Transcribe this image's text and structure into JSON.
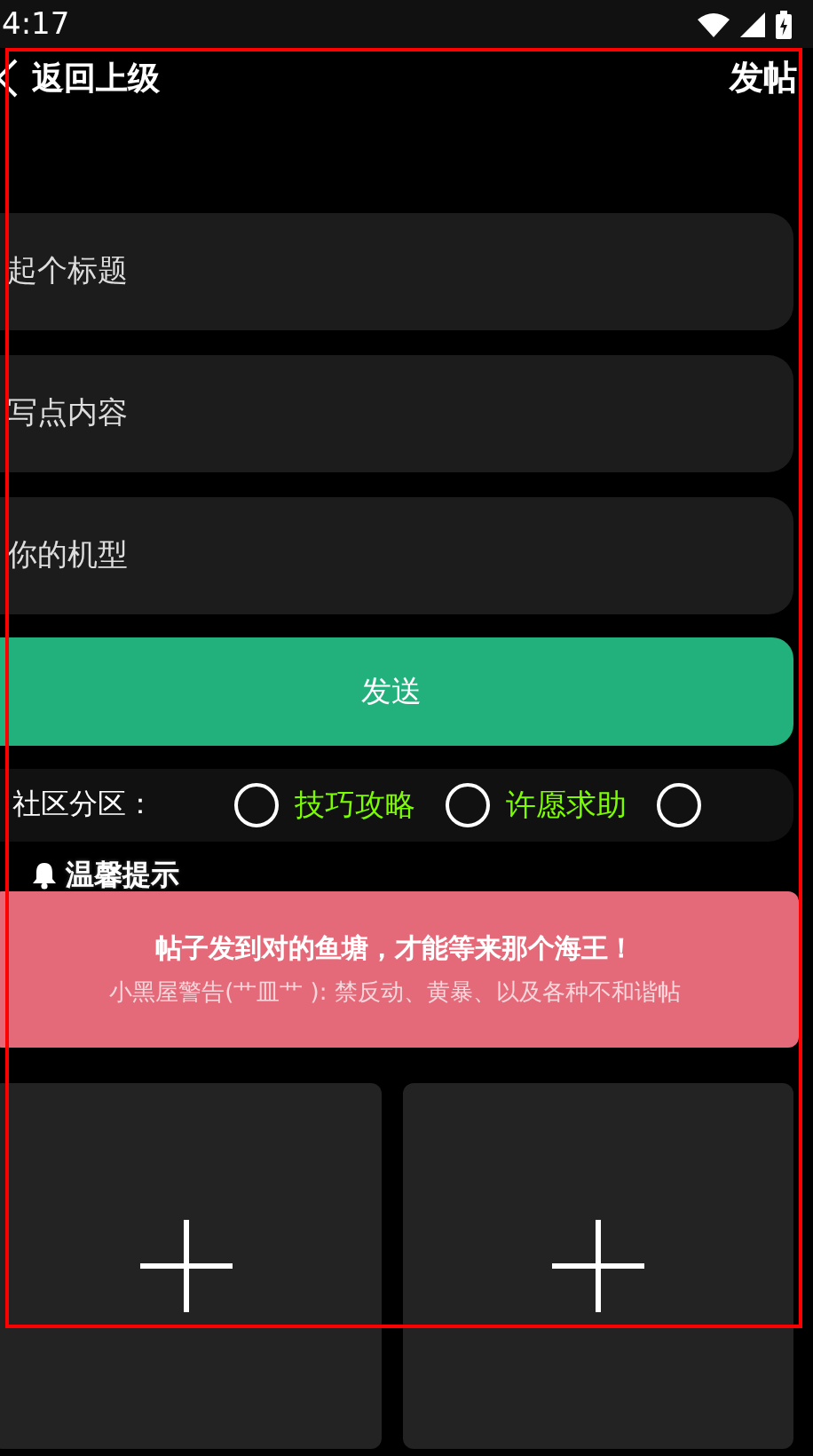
{
  "status_bar": {
    "time": "4:17"
  },
  "header": {
    "back_label": "返回上级",
    "action": "发帖"
  },
  "fields": [
    {
      "placeholder": "起个标题"
    },
    {
      "placeholder": "写点内容"
    },
    {
      "placeholder": "你的机型"
    }
  ],
  "send_button": "发送",
  "category": {
    "label": "社区分区：",
    "options": [
      {
        "label": "技巧攻略",
        "selected": false
      },
      {
        "label": "许愿求助",
        "selected": false
      },
      {
        "selected": false
      }
    ]
  },
  "tip": {
    "title": "温馨提示",
    "headline": "帖子发到对的鱼塘，才能等来那个海王！",
    "text": "小黑屋警告(艹皿艹 ): 禁反动、黄暴、以及各种不和谐帖"
  },
  "upload_slots": [
    {
      "kind": "add"
    },
    {
      "kind": "add"
    }
  ]
}
